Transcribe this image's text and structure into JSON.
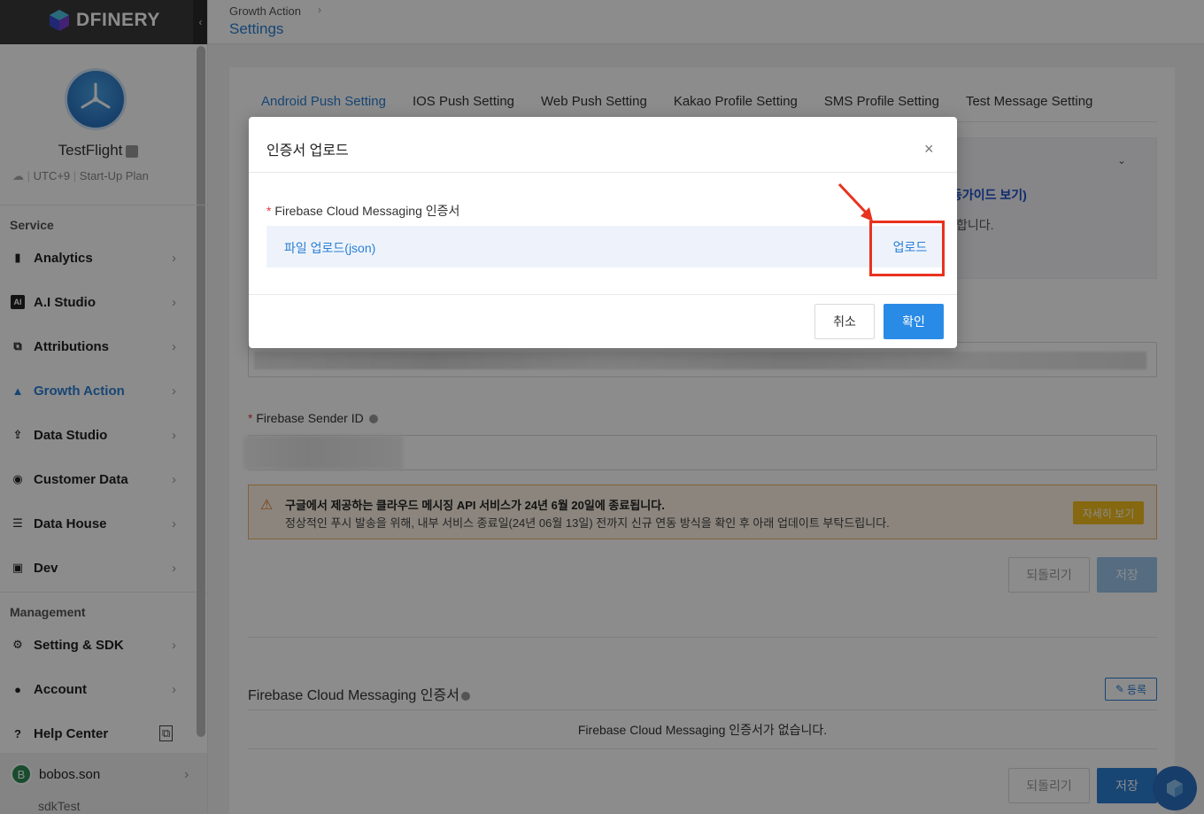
{
  "brand": {
    "name": "DFINERY"
  },
  "profile": {
    "app_name": "TestFlight",
    "timezone": "UTC+9",
    "plan": "Start-Up Plan"
  },
  "sidebar": {
    "service_label": "Service",
    "service_items": [
      {
        "label": "Analytics",
        "icon": "bar-chart-icon"
      },
      {
        "label": "A.I Studio",
        "icon": "ai-icon"
      },
      {
        "label": "Attributions",
        "icon": "attribution-icon"
      },
      {
        "label": "Growth Action",
        "icon": "growth-icon",
        "active": true
      },
      {
        "label": "Data Studio",
        "icon": "upload-icon"
      },
      {
        "label": "Customer Data",
        "icon": "target-icon"
      },
      {
        "label": "Data House",
        "icon": "database-icon"
      },
      {
        "label": "Dev",
        "icon": "dev-icon"
      }
    ],
    "management_label": "Management",
    "management_items": [
      {
        "label": "Setting & SDK",
        "icon": "gear-icon"
      },
      {
        "label": "Account",
        "icon": "user-icon"
      },
      {
        "label": "Help Center",
        "icon": "help-icon"
      }
    ],
    "user": {
      "initial": "B",
      "name": "bobos.son",
      "sub": "sdkTest"
    }
  },
  "header": {
    "breadcrumb": "Growth Action",
    "title": "Settings"
  },
  "tabs": [
    "Android Push Setting",
    "IOS Push Setting",
    "Web Push Setting",
    "Kakao Profile Setting",
    "SMS Profile Setting",
    "Test Message Setting"
  ],
  "guide": {
    "link": "동가이드 보기)",
    "tail": "합니다."
  },
  "form": {
    "sender_label": "Firebase Sender ID"
  },
  "warning": {
    "title": "구글에서 제공하는 클라우드 메시징 API 서비스가 24년 6월 20일에 종료됩니다.",
    "body": "정상적인 푸시 발송을 위해, 내부 서비스 종료일(24년 06월 13일) 전까지 신규 연동 방식을 확인 후 아래 업데이트 부탁드립니다.",
    "button": "자세히 보기"
  },
  "buttons": {
    "revert": "되돌리기",
    "save": "저장",
    "register": "등록"
  },
  "fcm_section": {
    "title": "Firebase Cloud Messaging 인증서",
    "empty": "Firebase Cloud Messaging 인증서가 없습니다."
  },
  "modal": {
    "title": "인증서 업로드",
    "field_label": "Firebase Cloud Messaging 인증서",
    "upload_text": "파일 업로드(json)",
    "upload_button": "업로드",
    "cancel": "취소",
    "confirm": "확인"
  },
  "colors": {
    "accent": "#2a7fd4",
    "primary_button": "#2a8be6",
    "highlight": "#e8321f",
    "warning_bg": "#fdf2e4"
  }
}
